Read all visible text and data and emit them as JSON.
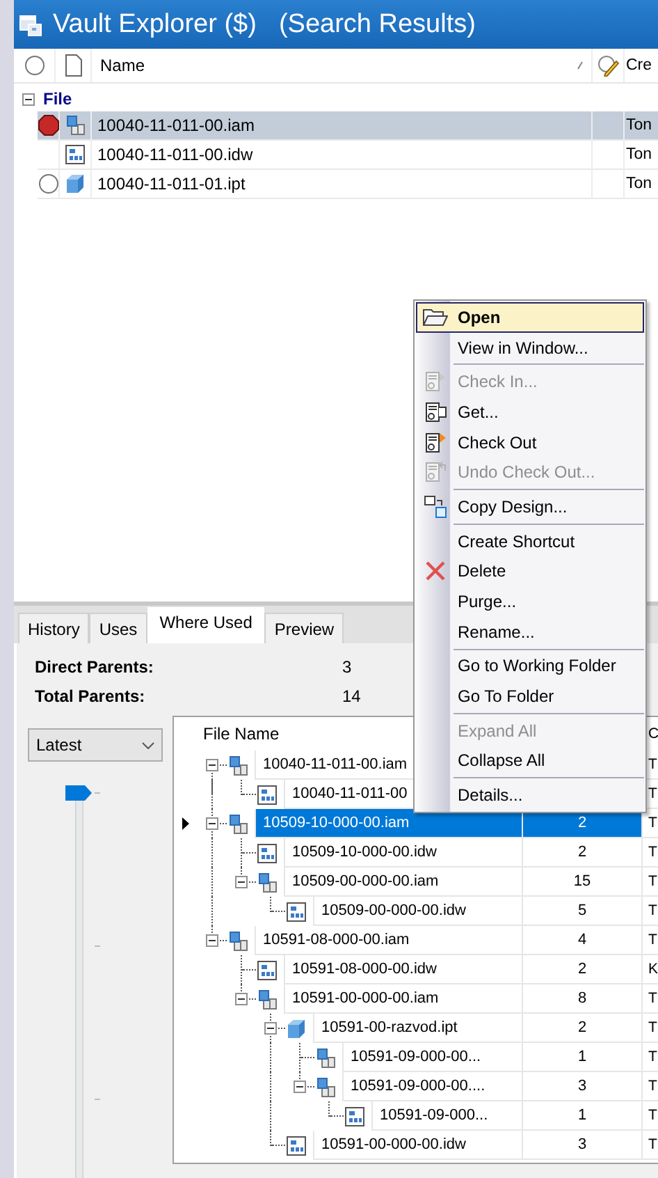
{
  "window": {
    "title": "Vault Explorer ($)",
    "subtitle": "(Search Results)"
  },
  "results": {
    "columns": [
      {
        "label": "Name",
        "sorted": true
      },
      {
        "label": "Cre",
        "sorted": false
      }
    ],
    "groups": [
      {
        "label": "File",
        "expanded": true,
        "rows": [
          {
            "status_shown": true,
            "checked_out": true,
            "kind": "assembly",
            "name": "10040-11-011-00.iam",
            "creator": "Ton",
            "selected": true
          },
          {
            "status_shown": false,
            "kind": "drawing",
            "name": "10040-11-011-00.idw",
            "creator": "Ton",
            "selected": false
          },
          {
            "status_shown": true,
            "checked_out": false,
            "kind": "part",
            "name": "10040-11-011-01.ipt",
            "creator": "Ton",
            "selected": false
          }
        ]
      }
    ]
  },
  "tabs": [
    {
      "label": "History",
      "selected": false
    },
    {
      "label": "Uses",
      "selected": false
    },
    {
      "label": "Where Used",
      "selected": true
    },
    {
      "label": "Preview",
      "selected": false
    }
  ],
  "where_used": {
    "stats": [
      {
        "label": "Direct Parents:",
        "value": "3"
      },
      {
        "label": "Total Parents:",
        "value": "14"
      }
    ],
    "version": {
      "value": "Latest"
    },
    "slider": {
      "level": 1
    },
    "headers": {
      "name": "File Name",
      "column_3": "C"
    },
    "rows": [
      {
        "name": "10040-11-011-00.iam",
        "kind": "assembly",
        "column_3": "T",
        "selected": false,
        "expanded": true,
        "children": [
          {
            "name": "10040-11-011-00",
            "kind": "drawing",
            "column_3": "T",
            "selected": false
          }
        ]
      },
      {
        "name": "10509-10-000-00.iam",
        "kind": "assembly",
        "count": "2",
        "column_3": "T",
        "selected": true,
        "expanded": true,
        "children": [
          {
            "name": "10509-10-000-00.idw",
            "kind": "drawing",
            "count": "2",
            "column_3": "T",
            "selected": false
          },
          {
            "name": "10509-00-000-00.iam",
            "kind": "assembly",
            "count": "15",
            "column_3": "T",
            "selected": false,
            "expanded": true,
            "children": [
              {
                "name": "10509-00-000-00.idw",
                "kind": "drawing",
                "count": "5",
                "column_3": "T",
                "selected": false
              }
            ]
          }
        ]
      },
      {
        "name": "10591-08-000-00.iam",
        "kind": "assembly",
        "count": "4",
        "column_3": "T",
        "selected": false,
        "expanded": true,
        "children": [
          {
            "name": "10591-08-000-00.idw",
            "kind": "drawing",
            "count": "2",
            "column_3": "K",
            "selected": false
          },
          {
            "name": "10591-00-000-00.iam",
            "kind": "assembly",
            "count": "8",
            "column_3": "T",
            "selected": false,
            "expanded": true,
            "children": [
              {
                "name": "10591-00-razvod.ipt",
                "kind": "part",
                "count": "2",
                "column_3": "T",
                "selected": false,
                "expanded": true,
                "children": [
                  {
                    "name": "10591-09-000-00...",
                    "kind": "assembly",
                    "count": "1",
                    "column_3": "T",
                    "selected": false
                  },
                  {
                    "name": "10591-09-000-00....",
                    "kind": "assembly",
                    "count": "3",
                    "column_3": "T",
                    "selected": false,
                    "expanded": true,
                    "children": [
                      {
                        "name": "10591-09-000...",
                        "kind": "drawing",
                        "count": "1",
                        "column_3": "T",
                        "selected": false
                      }
                    ]
                  }
                ]
              },
              {
                "name": "10591-00-000-00.idw",
                "kind": "drawing",
                "count": "3",
                "column_3": "T",
                "selected": false
              }
            ]
          }
        ]
      }
    ]
  },
  "context_menu": {
    "items": [
      {
        "kind": "open",
        "label": "Open",
        "default": true,
        "highlighted": true,
        "disabled": false
      },
      {
        "kind": "plain",
        "label": "View in Window...",
        "default": false,
        "highlighted": false,
        "disabled": false
      },
      {
        "kind": "separator"
      },
      {
        "kind": "check_in",
        "label": "Check In...",
        "default": false,
        "highlighted": false,
        "disabled": true
      },
      {
        "kind": "get",
        "label": "Get...",
        "default": false,
        "highlighted": false,
        "disabled": false
      },
      {
        "kind": "check_out",
        "label": "Check Out",
        "default": false,
        "highlighted": false,
        "disabled": false
      },
      {
        "kind": "undo",
        "label": "Undo Check Out...",
        "default": false,
        "highlighted": false,
        "disabled": true
      },
      {
        "kind": "separator"
      },
      {
        "kind": "copy",
        "label": "Copy Design...",
        "default": false,
        "highlighted": false,
        "disabled": false
      },
      {
        "kind": "separator"
      },
      {
        "kind": "plain",
        "label": "Create Shortcut",
        "default": false,
        "highlighted": false,
        "disabled": false
      },
      {
        "kind": "delete",
        "label": "Delete",
        "default": false,
        "highlighted": false,
        "disabled": false
      },
      {
        "kind": "plain",
        "label": "Purge...",
        "default": false,
        "highlighted": false,
        "disabled": false
      },
      {
        "kind": "plain",
        "label": "Rename...",
        "default": false,
        "highlighted": false,
        "disabled": false
      },
      {
        "kind": "separator"
      },
      {
        "kind": "plain",
        "label": "Go to Working Folder",
        "default": false,
        "highlighted": false,
        "disabled": false
      },
      {
        "kind": "plain",
        "label": "Go To Folder",
        "default": false,
        "highlighted": false,
        "disabled": false
      },
      {
        "kind": "separator"
      },
      {
        "kind": "plain",
        "label": "Expand All",
        "default": false,
        "highlighted": false,
        "disabled": true
      },
      {
        "kind": "plain",
        "label": "Collapse All",
        "default": false,
        "highlighted": false,
        "disabled": false
      },
      {
        "kind": "separator"
      },
      {
        "kind": "plain",
        "label": "Details...",
        "default": false,
        "highlighted": false,
        "disabled": false
      }
    ]
  }
}
